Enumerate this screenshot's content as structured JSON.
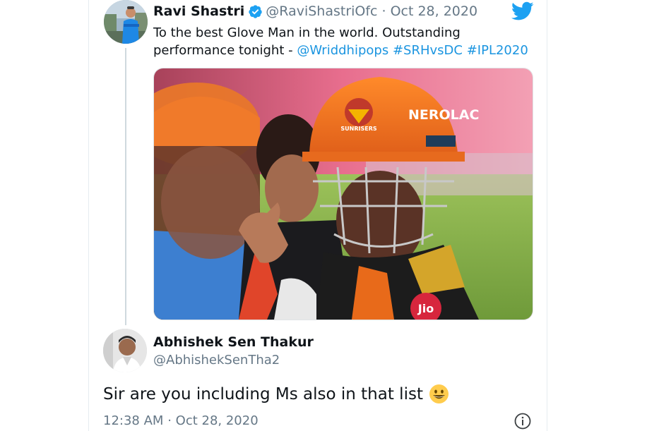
{
  "parent_tweet": {
    "author_name": "Ravi Shastri",
    "author_handle": "@RaviShastriOfc",
    "separator": "·",
    "date": "Oct 28, 2020",
    "text_prefix": "To the best Glove Man in the world. Outstanding performance tonight - ",
    "mention": "@Wriddhipops",
    "hashtags": [
      "#SRHvsDC",
      "#IPL2020"
    ],
    "icons": {
      "verified": "verified-badge-icon",
      "brand": "twitter-bird-icon"
    },
    "media": {
      "helmet_brand": "NEROLAC",
      "helmet_emblem": "SUNRISERS",
      "jersey_sponsor": "Jio"
    }
  },
  "reply_tweet": {
    "author_name": "Abhishek Sen Thakur",
    "author_handle": "@AbhishekSenTha2",
    "text": "Sir are you including Ms also in that list",
    "emoji": "grinning-face-emoji",
    "time": "12:38 AM",
    "separator": "·",
    "date": "Oct 28, 2020",
    "icons": {
      "info": "info-icon"
    }
  },
  "colors": {
    "link": "#1b95e0",
    "secondary_text": "#657786",
    "twitter_blue": "#1da1f2",
    "thread_line": "#cfd9de"
  }
}
